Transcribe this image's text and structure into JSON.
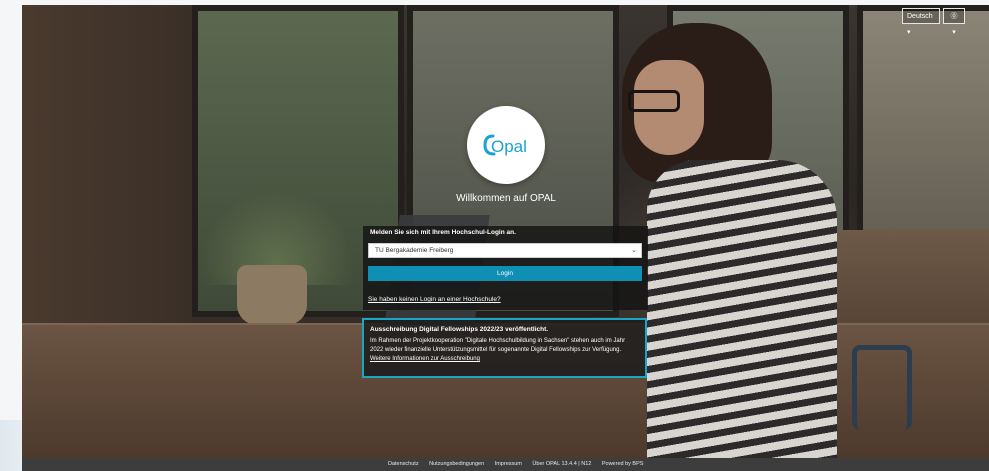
{
  "header": {
    "language_label": "Deutsch ▾",
    "help_label": "⓪ ▾"
  },
  "logo": {
    "text": "Opal"
  },
  "welcome_text": "Willkommen auf OPAL",
  "login": {
    "title": "Melden Sie sich mit Ihrem Hochschul-Login an.",
    "institution_select_value": "TU Bergakademie Freiberg",
    "login_button": "Login",
    "no_login_link": "Sie haben keinen Login an einer Hochschule?"
  },
  "announcement": {
    "title": "Ausschreibung Digital Fellowships 2022/23 veröffentlicht.",
    "text": "Im Rahmen der Projektkooperation \"Digitale Hochschulbildung in Sachsen\" stehen auch im Jahr 2022 wieder finanzielle Unterstützungsmittel für sogenannte Digital Fellowships zur Verfügung.",
    "link": "Weitere Informationen zur Ausschreibung"
  },
  "footer": {
    "links": [
      "Datenschutz",
      "Nutzungsbedingungen",
      "Impressum",
      "Über OPAL 13.4.4 | N12",
      "Powered by BPS"
    ]
  },
  "colors": {
    "accent": "#0f8fb4",
    "announcement_border": "#19a5c6",
    "logo_blue": "#1aa3d4"
  }
}
